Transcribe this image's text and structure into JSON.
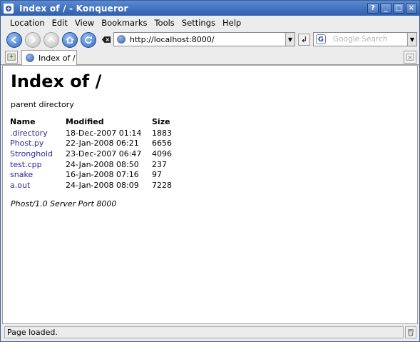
{
  "window": {
    "title": "Index of / - Konqueror",
    "buttons": [
      "?",
      "_",
      "□",
      "×"
    ]
  },
  "menubar": {
    "items": [
      "Location",
      "Edit",
      "View",
      "Bookmarks",
      "Tools",
      "Settings",
      "Help"
    ]
  },
  "toolbar": {
    "buttons": [
      "back-icon",
      "forward-icon",
      "up-icon",
      "home-icon",
      "reload-icon"
    ],
    "url": "http://localhost:8000/",
    "search_placeholder": "Google Search"
  },
  "tabs": [
    {
      "label": "Index of /"
    }
  ],
  "page": {
    "heading": "Index of /",
    "parent_link": "parent directory",
    "columns": [
      "Name",
      "Modified",
      "Size"
    ],
    "rows": [
      {
        "name": ".directory",
        "modified": "18-Dec-2007 01:14",
        "size": "1883"
      },
      {
        "name": "Phost.py",
        "modified": "22-Jan-2008 06:21",
        "size": "6656"
      },
      {
        "name": "Stronghold",
        "modified": "23-Dec-2007 06:47",
        "size": "4096"
      },
      {
        "name": "test.cpp",
        "modified": "24-Jan-2008 08:50",
        "size": "237"
      },
      {
        "name": "snake",
        "modified": "16-Jan-2008 07:16",
        "size": "97"
      },
      {
        "name": "a.out",
        "modified": "24-Jan-2008 08:09",
        "size": "7228"
      }
    ],
    "footer": "Phost/1.0 Server Port 8000"
  },
  "statusbar": {
    "text": "Page loaded."
  },
  "colors": {
    "titlebar": "#2f5fae",
    "link": "#2a2a9a"
  }
}
